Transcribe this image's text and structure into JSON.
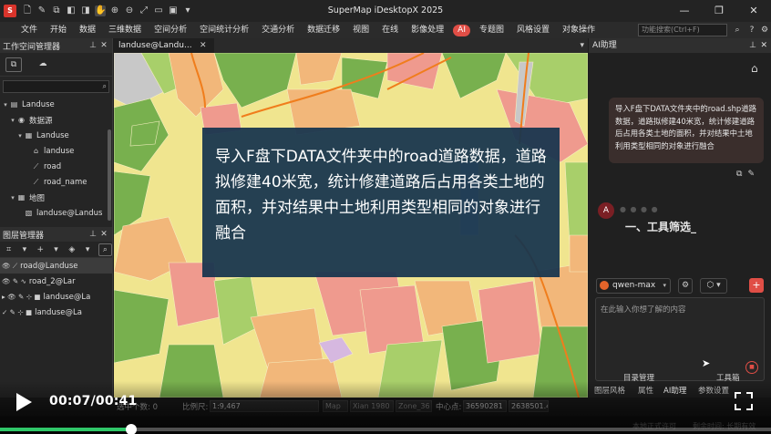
{
  "window": {
    "title": "SuperMap iDesktopX 2025",
    "controls": {
      "minimize": "—",
      "restore": "❐",
      "close": "✕"
    }
  },
  "quick_access": [
    "🗋",
    "✎",
    "⧉",
    "◧",
    "◨",
    "✋",
    "⊕",
    "⊖",
    "⤢",
    "▭",
    "▣",
    "▾"
  ],
  "menu": {
    "items": [
      "文件",
      "开始",
      "数据",
      "三维数据",
      "空间分析",
      "空间统计分析",
      "交通分析",
      "数据迁移",
      "视图",
      "在线",
      "影像处理",
      "AI",
      "专题图",
      "风格设置",
      "对象操作"
    ],
    "highlight_index": 11,
    "search_placeholder": "功能搜索(Ctrl+F)"
  },
  "workspace_panel": {
    "title": "工作空间管理器",
    "tree": [
      {
        "indent": 0,
        "caret": "▾",
        "icon": "▤",
        "label": "Landuse"
      },
      {
        "indent": 1,
        "caret": "▾",
        "icon": "◉",
        "label": "数据源"
      },
      {
        "indent": 2,
        "caret": "▾",
        "icon": "▦",
        "label": "Landuse"
      },
      {
        "indent": 3,
        "caret": "",
        "icon": "⌂",
        "label": "landuse"
      },
      {
        "indent": 3,
        "caret": "",
        "icon": "⟋",
        "label": "road"
      },
      {
        "indent": 3,
        "caret": "",
        "icon": "⟋",
        "label": "road_name"
      },
      {
        "indent": 1,
        "caret": "▾",
        "icon": "▦",
        "label": "地图"
      },
      {
        "indent": 2,
        "caret": "",
        "icon": "▧",
        "label": "landuse@Landus"
      }
    ]
  },
  "layer_panel": {
    "title": "图层管理器",
    "layers": [
      {
        "label": "road@Landuse",
        "selected": true,
        "prefix": "👁 ⟋"
      },
      {
        "label": "road_2@Lar",
        "selected": false,
        "prefix": "👁 ✎ ∿"
      },
      {
        "label": "landuse@La",
        "selected": false,
        "prefix": "▸ 👁 ✎ ⊹ ■"
      },
      {
        "label": "landuse@La",
        "selected": false,
        "prefix": "✓ ✎ ⊹ ■"
      }
    ]
  },
  "map": {
    "tab_label": "landuse@Landu...",
    "overlay_text": "导入F盘下DATA文件夹中的road道路数据，道路拟修建40米宽，统计修建道路后占用各类土地的面积，并对结果中土地利用类型相同的对象进行融合",
    "colors": {
      "yellow": "#f0e58f",
      "orange": "#f2b77a",
      "pink": "#ef9a8e",
      "green": "#78b04e",
      "lightgreen": "#a8cf6a",
      "gray": "#c8c8c8",
      "lilac": "#d6b8e0",
      "road_orange": "#f07d1c",
      "overlay": "#16344e"
    }
  },
  "ai_panel": {
    "title": "AI助理",
    "user_message": "导入F盘下DATA文件夹中的road.shp道路数据，道路拟修建40米宽，统计修建道路后占用各类土地的面积，并对结果中土地利用类型相同的对象进行融合",
    "response_heading": "一、工具筛选_",
    "model_name": "qwen-max",
    "input_placeholder": "在此输入你想了解的内容",
    "bottom_tabs": [
      "目录管理",
      "工具箱",
      "图层风格",
      "属性",
      "AI助理",
      "参数设置"
    ]
  },
  "statusbar": {
    "selected_count_label": "选中个数: 0",
    "scale_label": "比例尺:",
    "scale_value": "1:9,467",
    "map_field": "Map",
    "coord_system": "Xian 1980",
    "zone": "Zone_36",
    "center_label": "中心点:",
    "center_x": "36590281",
    "center_y": "2638501.4",
    "license": "本地正式许可",
    "remaining": "剩余时间: 长期有效"
  },
  "video": {
    "time": "00:07/00:41",
    "progress_fraction": 0.17
  }
}
